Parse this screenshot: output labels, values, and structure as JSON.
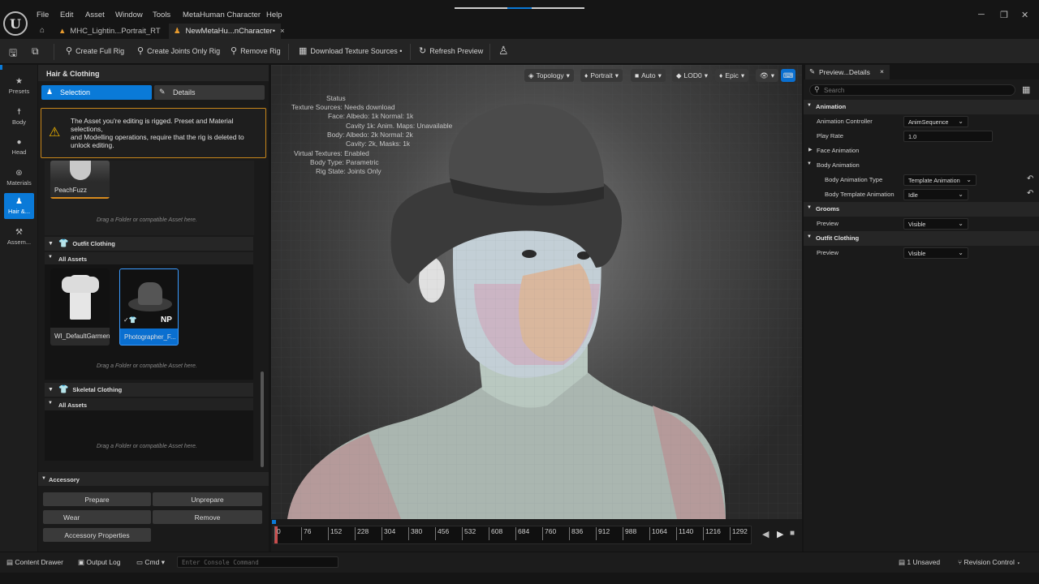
{
  "menu": {
    "file": "File",
    "edit": "Edit",
    "asset": "Asset",
    "window": "Window",
    "tools": "Tools",
    "metahuman": "MetaHuman Character",
    "help": "Help"
  },
  "tabs": {
    "tab1": "MHC_Lightin...Portrait_RT",
    "tab2": "NewMetaHu...nCharacter•"
  },
  "toolbar": {
    "create_full_rig": "Create Full Rig",
    "create_joints": "Create Joints Only Rig",
    "remove_rig": "Remove Rig",
    "download_textures": "Download Texture Sources •",
    "refresh_preview": "Refresh Preview"
  },
  "leftnav": {
    "presets": "Presets",
    "body": "Body",
    "head": "Head",
    "materials": "Materials",
    "hair": "Hair &...",
    "assembly": "Assem..."
  },
  "panel": {
    "title": "Hair & Clothing",
    "tab_selection": "Selection",
    "tab_details": "Details",
    "warning": "The Asset you're editing is rigged. Preset and Material selections,\nand Modelling operations, require that the rig is deleted to unlock editing.",
    "peachfuzz": "PeachFuzz",
    "drop_hint": "Drag a Folder or compatible Asset here.",
    "outfit_clothing": "Outfit Clothing",
    "all_assets": "All Assets",
    "garment1": "WI_DefaultGarment",
    "garment2": "Photographer_F...",
    "np_badge": "NP",
    "skeletal_clothing": "Skeletal Clothing"
  },
  "accessory": {
    "title": "Accessory",
    "prepare": "Prepare",
    "unprepare": "Unprepare",
    "wear": "Wear",
    "remove": "Remove",
    "properties": "Accessory Properties"
  },
  "viewport": {
    "topology": "Topology",
    "portrait": "Portrait",
    "auto": "Auto",
    "lod": "LOD0",
    "epic": "Epic"
  },
  "status": {
    "title": "Status",
    "l1": "Texture Sources: Needs download",
    "l2": "Face: Albedo: 1k Normal: 1k",
    "l3": "Cavity 1k: Anim. Maps: Unavailable",
    "l4": "Body: Albedo: 2k Normal: 2k",
    "l5": "Cavity: 2k, Masks: 1k",
    "l6": "Virtual Textures: Enabled",
    "l7": "Body Type: Parametric",
    "l8": "Rig State: Joints Only"
  },
  "timeline": {
    "ticks": [
      "0",
      "76",
      "152",
      "228",
      "304",
      "380",
      "456",
      "532",
      "608",
      "684",
      "760",
      "836",
      "912",
      "988",
      "1064",
      "1140",
      "1216",
      "1292"
    ]
  },
  "details": {
    "tab": "Preview...Details",
    "search": "Search",
    "animation": "Animation",
    "anim_controller": "Animation Controller",
    "anim_controller_val": "AnimSequence",
    "play_rate": "Play Rate",
    "play_rate_val": "1.0",
    "face_animation": "Face Animation",
    "body_animation": "Body Animation",
    "body_anim_type": "Body Animation Type",
    "body_anim_type_val": "Template Animation",
    "body_template_anim": "Body Template Animation",
    "body_template_anim_val": "Idle",
    "grooms": "Grooms",
    "preview": "Preview",
    "visible": "Visible",
    "outfit_clothing": "Outfit Clothing"
  },
  "statusbar": {
    "content_drawer": "Content Drawer",
    "output_log": "Output Log",
    "cmd": "Cmd",
    "console_placeholder": "Enter Console Command",
    "unsaved": "1 Unsaved",
    "revision": "Revision Control"
  }
}
